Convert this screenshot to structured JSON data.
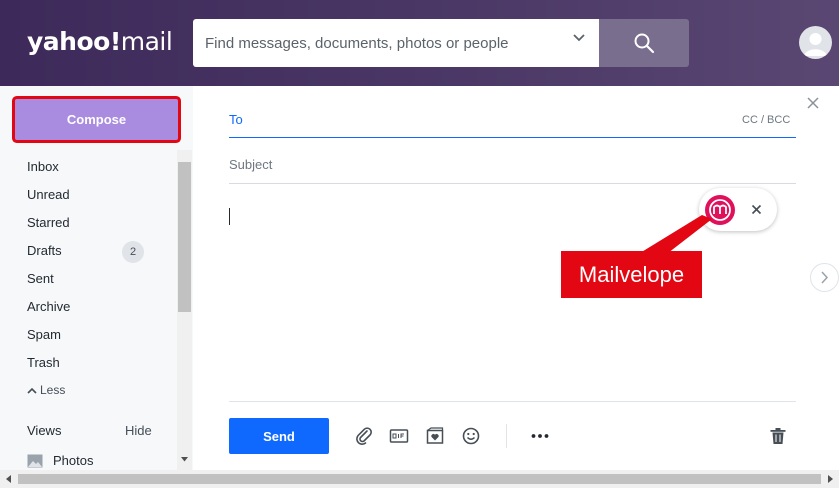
{
  "app": {
    "logo_text": "yahoo!",
    "logo_suffix": "mail"
  },
  "search": {
    "placeholder": "Find messages, documents, photos or people"
  },
  "sidebar": {
    "compose_label": "Compose",
    "items": [
      {
        "label": "Inbox"
      },
      {
        "label": "Unread"
      },
      {
        "label": "Starred"
      },
      {
        "label": "Drafts",
        "badge": "2"
      },
      {
        "label": "Sent"
      },
      {
        "label": "Archive"
      },
      {
        "label": "Spam"
      },
      {
        "label": "Trash"
      }
    ],
    "less_label": "Less",
    "views_label": "Views",
    "hide_label": "Hide",
    "photos_label": "Photos"
  },
  "compose": {
    "to_label": "To",
    "ccbcc_label": "CC / BCC",
    "subject_label": "Subject",
    "send_label": "Send"
  },
  "annotation": {
    "callout_text": "Mailvelope"
  },
  "colors": {
    "header_bg": "#4b3866",
    "compose_button": "#a98be0",
    "highlight_red": "#e30613",
    "send_button": "#0f69ff",
    "mailvelope_brand": "#e0105b"
  },
  "icons": {
    "search": "magnifier-icon",
    "avatar": "user-avatar-icon",
    "attach": "paperclip-icon",
    "gif": "gif-icon",
    "sticker": "sticker-heart-icon",
    "emoji": "smiley-icon",
    "more": "more-dots-icon",
    "delete": "trash-icon"
  }
}
